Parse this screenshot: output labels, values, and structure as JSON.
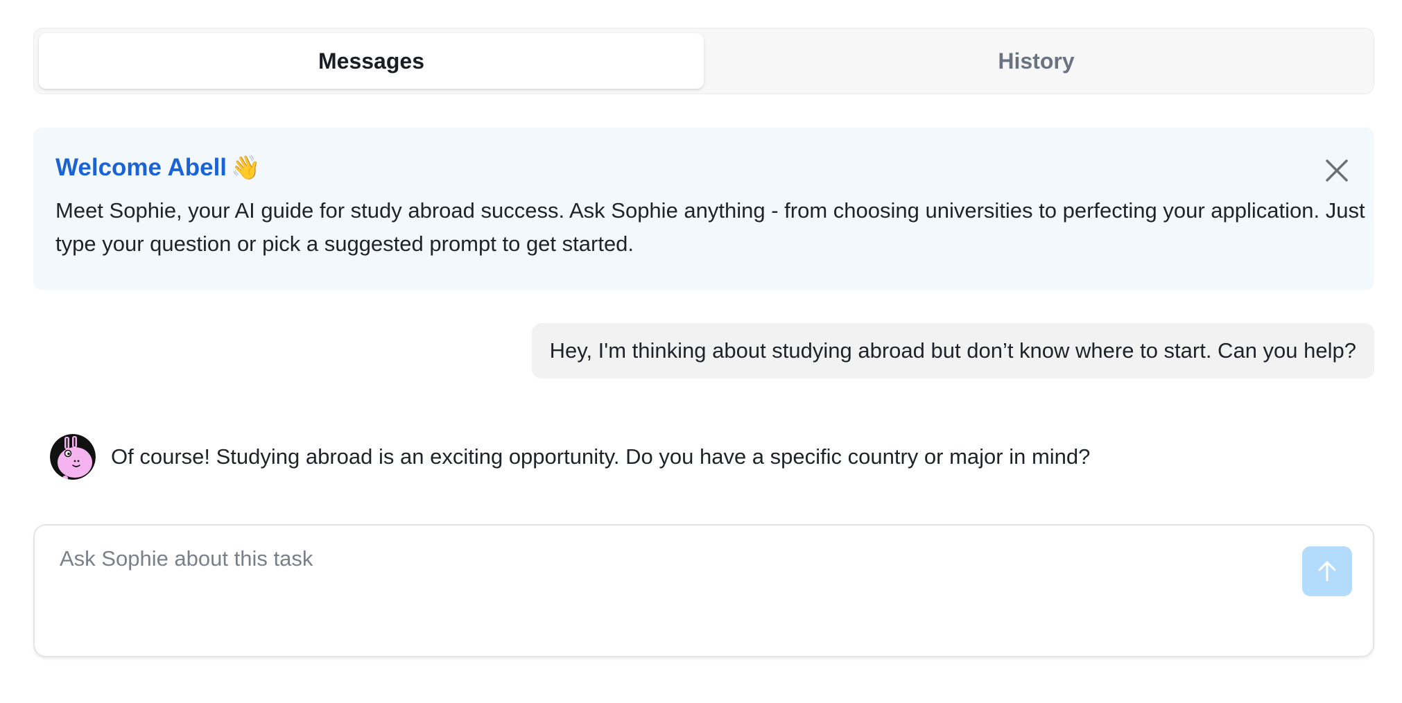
{
  "tabs": [
    {
      "label": "Messages",
      "active": true
    },
    {
      "label": "History",
      "active": false
    }
  ],
  "welcome": {
    "title": "Welcome Abell",
    "emoji": "👋",
    "body": "Meet Sophie, your AI guide for study abroad success. Ask Sophie anything - from choosing universities to perfecting your application. Just type your question or pick a suggested prompt to get started.",
    "close_icon": "close-icon",
    "title_color": "#1a63d6",
    "background_color": "#f3f8fd"
  },
  "messages": [
    {
      "role": "user",
      "text": "Hey, I'm thinking about studying abroad but don’t know where to start. Can you help?"
    },
    {
      "role": "assistant",
      "text": "Of course! Studying abroad is an exciting opportunity. Do you have a specific country or major in mind?",
      "avatar_icon": "sophie-avatar"
    }
  ],
  "composer": {
    "placeholder": "Ask Sophie about this task",
    "value": "",
    "send_icon": "arrow-up-icon",
    "send_color": "#b3dbfb"
  }
}
